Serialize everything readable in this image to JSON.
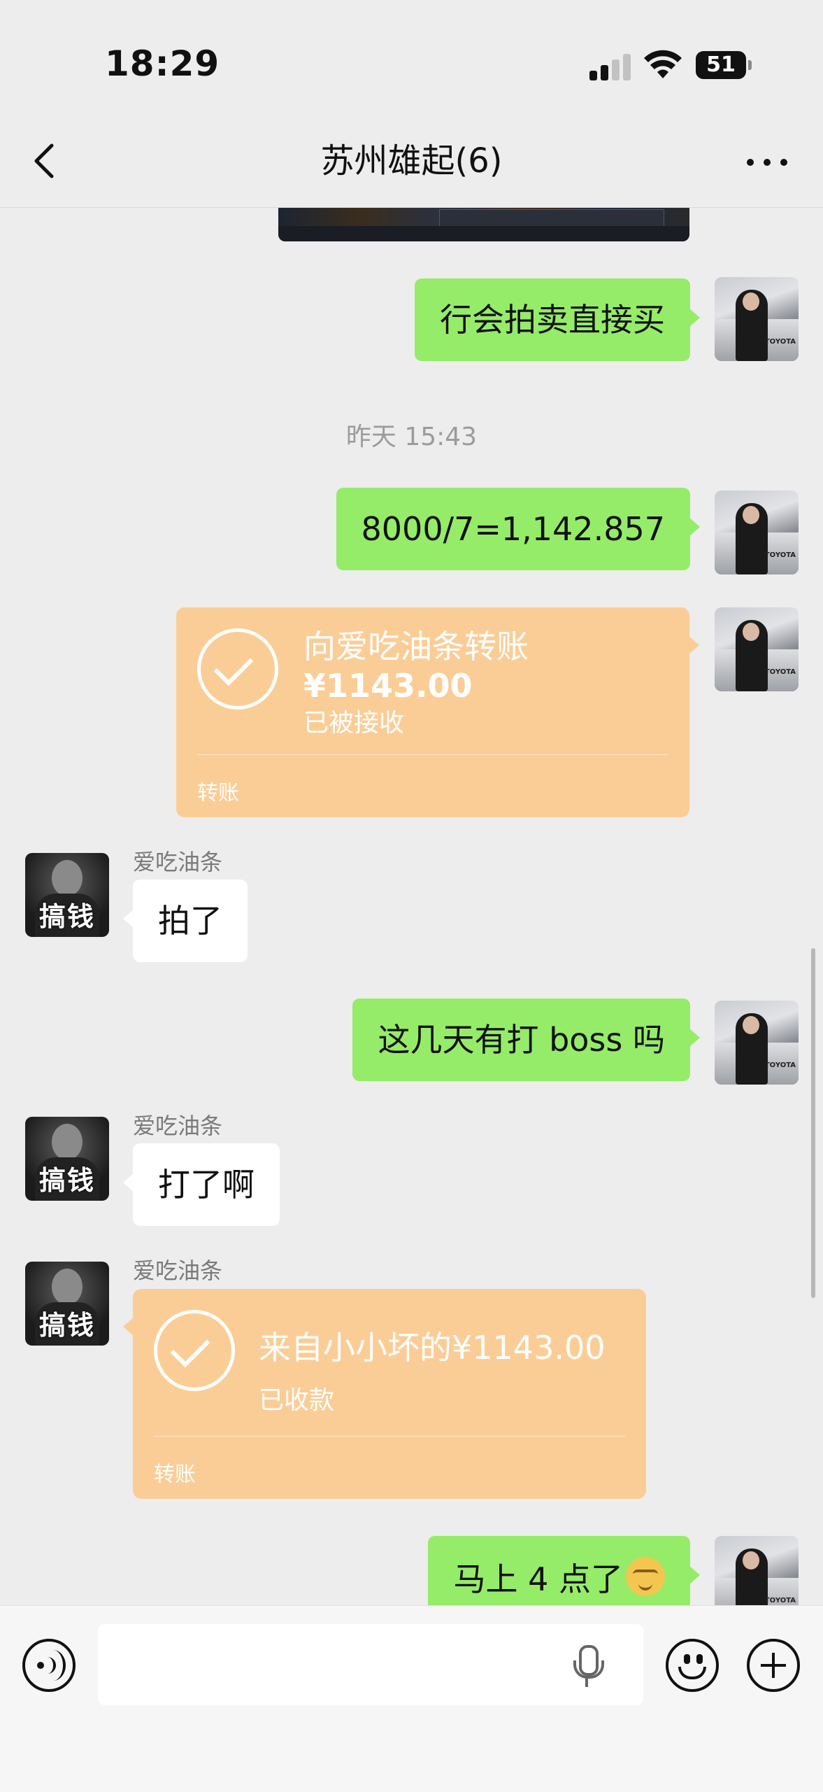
{
  "status_bar": {
    "time": "18:29",
    "battery": "51"
  },
  "header": {
    "title": "苏州雄起(6)"
  },
  "messages": {
    "m1": "行会拍卖直接买",
    "timestamp": "昨天 15:43",
    "m2": "8000/7=1,142.857",
    "transfer_out": {
      "title": "向爱吃油条转账",
      "amount": "¥1143.00",
      "status": "已被接收",
      "footer": "转账"
    },
    "sender_name": "爱吃油条",
    "m3": "拍了",
    "m4": "这几天有打 boss 吗",
    "m5": "打了啊",
    "transfer_in": {
      "title": "来自小小坏的¥1143.00",
      "status": "已收款",
      "footer": "转账"
    },
    "m6": "马上 4 点了"
  },
  "colors": {
    "bubble_green": "#95ec69",
    "transfer_orange": "#fbcd96",
    "background": "#ededed"
  },
  "icons": [
    "back-arrow-icon",
    "more-icon",
    "voice-icon",
    "microphone-icon",
    "emoji-icon",
    "plus-icon",
    "check-icon"
  ]
}
